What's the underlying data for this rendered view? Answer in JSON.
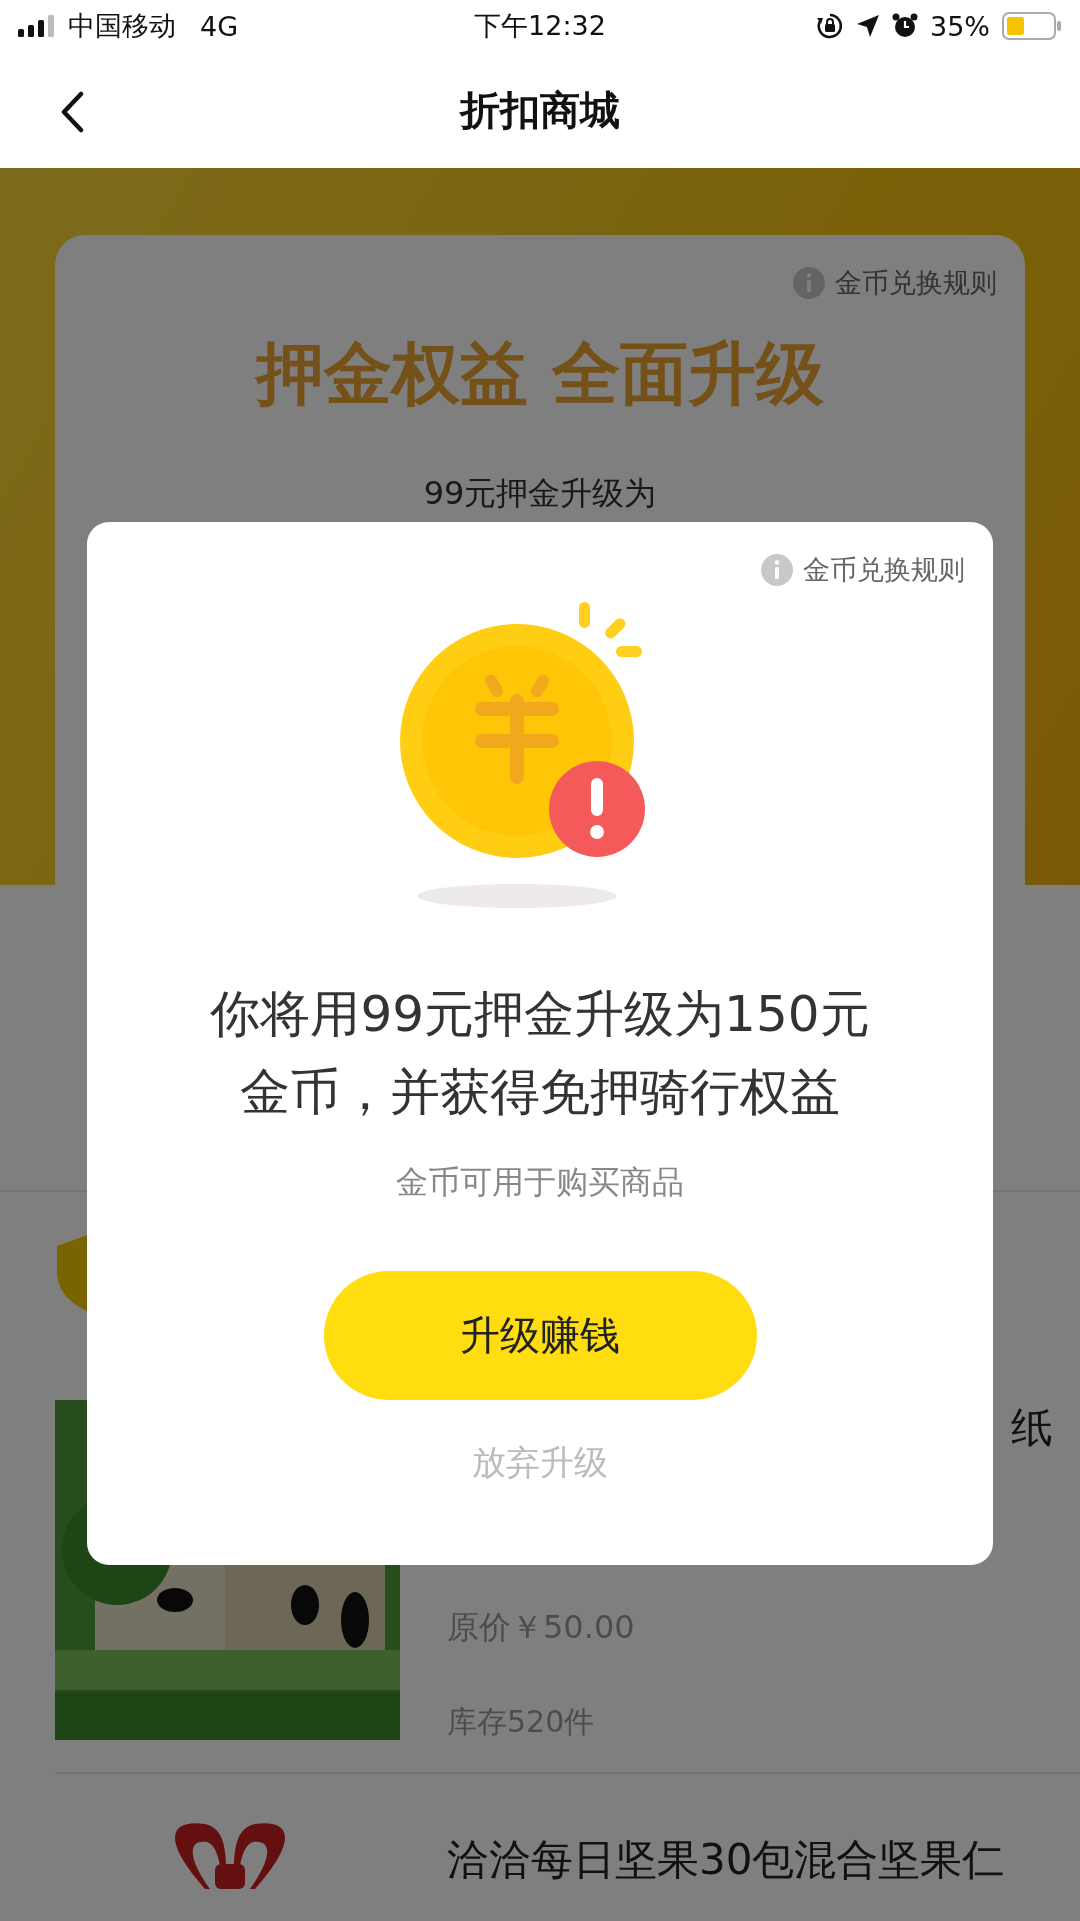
{
  "status_bar": {
    "carrier": "中国移动",
    "network": "4G",
    "time": "下午12:32",
    "battery": "35%"
  },
  "nav": {
    "title": "折扣商城"
  },
  "banner": {
    "rules_link": "金币兑换规则",
    "headline": "押金权益 全面升级",
    "subline": "99元押金升级为"
  },
  "products": [
    {
      "title": "纸",
      "original_price": "原价￥50.00",
      "stock": "库存520件"
    },
    {
      "title": "洽洽每日坚果30包混合坚果仁"
    }
  ],
  "modal": {
    "rules_link": "金币兑换规则",
    "message_lines": [
      "你将用99元押金升级为150元",
      "金币，并获得免押骑行权益"
    ],
    "note": "金币可用于购买商品",
    "confirm_button": "升级赚钱",
    "cancel_button": "放弃升级"
  }
}
